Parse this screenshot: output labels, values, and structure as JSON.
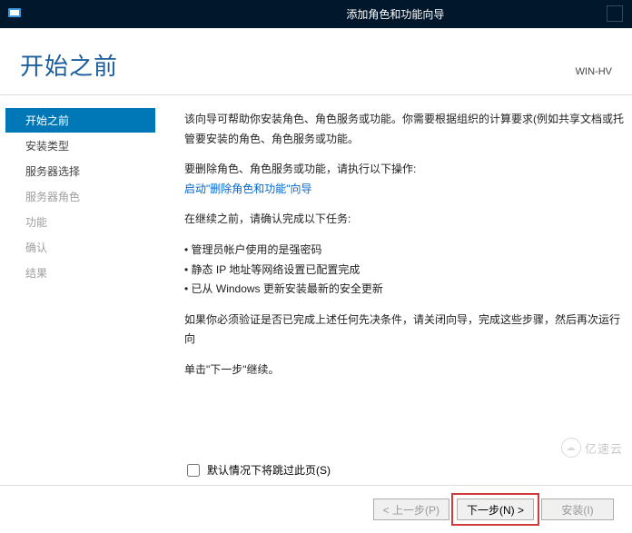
{
  "window": {
    "title": "添加角色和功能向导"
  },
  "header": {
    "page_title": "开始之前",
    "server_name": "WIN-HV"
  },
  "sidebar": {
    "items": [
      {
        "label": "开始之前",
        "state": "active"
      },
      {
        "label": "安装类型",
        "state": "enabled"
      },
      {
        "label": "服务器选择",
        "state": "enabled"
      },
      {
        "label": "服务器角色",
        "state": "disabled"
      },
      {
        "label": "功能",
        "state": "disabled"
      },
      {
        "label": "确认",
        "state": "disabled"
      },
      {
        "label": "结果",
        "state": "disabled"
      }
    ]
  },
  "content": {
    "intro": "该向导可帮助你安装角色、角色服务或功能。你需要根据组织的计算要求(例如共享文档或托管要安装的角色、角色服务或功能。",
    "remove_heading": "要删除角色、角色服务或功能，请执行以下操作:",
    "remove_link": "启动\"删除角色和功能\"向导",
    "tasks_heading": "在继续之前，请确认完成以下任务:",
    "tasks": [
      "管理员帐户使用的是强密码",
      "静态 IP 地址等网络设置已配置完成",
      "已从 Windows 更新安装最新的安全更新"
    ],
    "verify_note": "如果你必须验证是否已完成上述任何先决条件，请关闭向导，完成这些步骤，然后再次运行向",
    "continue_note": "单击\"下一步\"继续。",
    "skip_checkbox_label": "默认情况下将跳过此页(S)"
  },
  "buttons": {
    "previous": "< 上一步(P)",
    "next": "下一步(N) >",
    "install": "安装(I)"
  },
  "watermark": {
    "text": "亿速云"
  }
}
